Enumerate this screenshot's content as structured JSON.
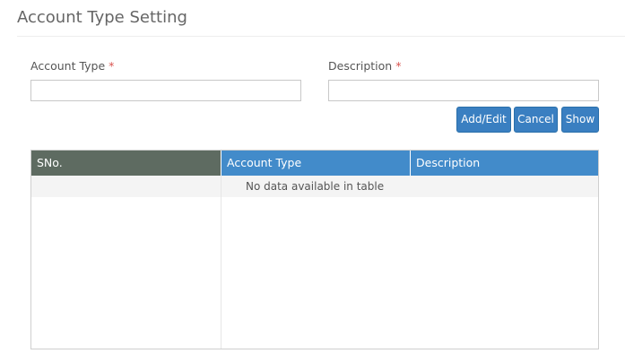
{
  "page": {
    "title": "Account Type Setting"
  },
  "form": {
    "account_type": {
      "label": "Account Type",
      "required_mark": "*",
      "value": "",
      "placeholder": ""
    },
    "description": {
      "label": "Description",
      "required_mark": "*",
      "value": "",
      "placeholder": ""
    }
  },
  "buttons": {
    "add_edit": "Add/Edit",
    "cancel": "Cancel",
    "show": "Show"
  },
  "table": {
    "columns": [
      "SNo.",
      "Account Type",
      "Description"
    ],
    "rows": [],
    "empty_message": "No data available in table"
  },
  "colors": {
    "accent": "#428bca",
    "header_sno": "#5e6b61",
    "required": "#d9534f"
  }
}
